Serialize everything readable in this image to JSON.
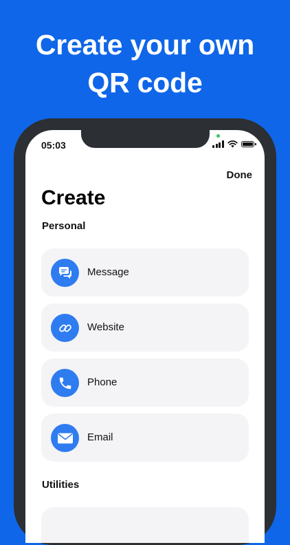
{
  "promo": {
    "headline_line1": "Create your own",
    "headline_line2": "QR code"
  },
  "status_bar": {
    "time": "05:03"
  },
  "header": {
    "done_label": "Done",
    "title": "Create"
  },
  "sections": {
    "personal": {
      "label": "Personal",
      "items": [
        {
          "label": "Message",
          "icon": "message-bubbles-icon"
        },
        {
          "label": "Website",
          "icon": "link-icon"
        },
        {
          "label": "Phone",
          "icon": "phone-icon"
        },
        {
          "label": "Email",
          "icon": "envelope-icon"
        }
      ]
    },
    "utilities": {
      "label": "Utilities"
    }
  },
  "colors": {
    "background": "#0f66e8",
    "accent": "#2f7cf1",
    "row_background": "#f4f4f6",
    "phone_frame": "#2c2f33"
  }
}
